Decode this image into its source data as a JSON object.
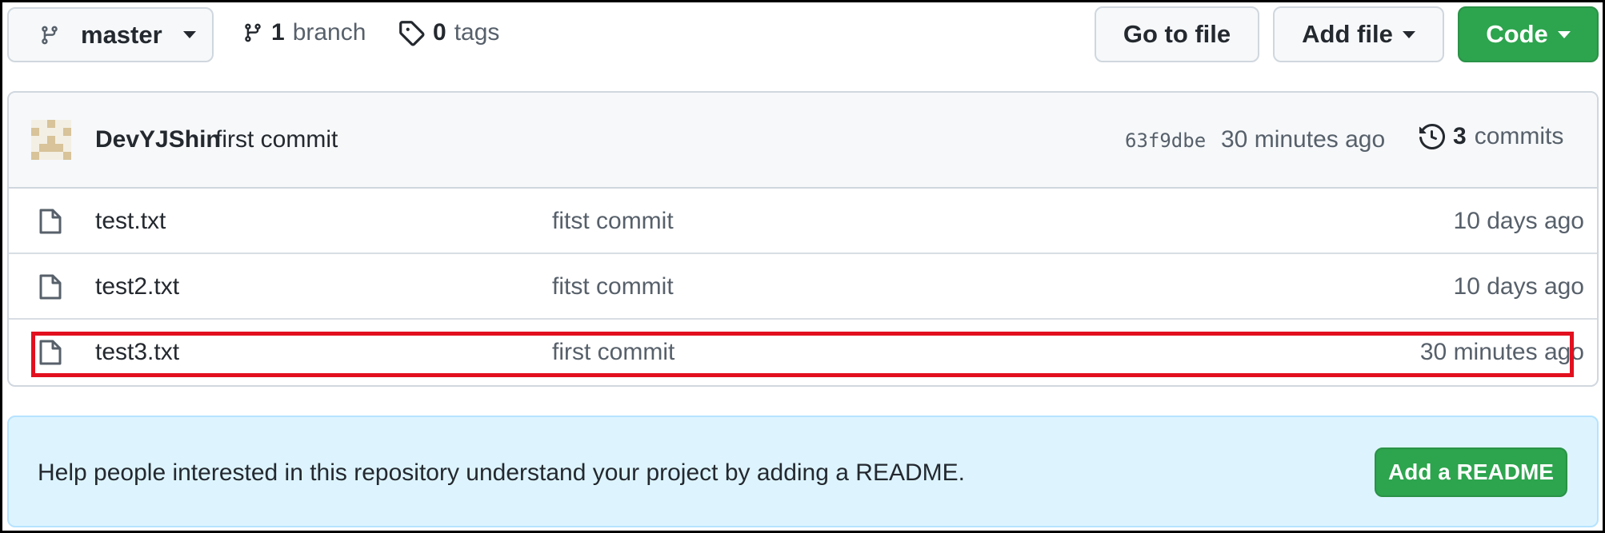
{
  "toolbar": {
    "branch_name": "master",
    "branches_count": "1",
    "branches_label": "branch",
    "tags_count": "0",
    "tags_label": "tags",
    "go_to_file_label": "Go to file",
    "add_file_label": "Add file",
    "code_label": "Code"
  },
  "latest_commit": {
    "author": "DevYJShin",
    "message": "first commit",
    "sha": "63f9dbe",
    "time": "30 minutes ago",
    "commits_count": "3",
    "commits_label": "commits"
  },
  "files": [
    {
      "name": "test.txt",
      "message": "fitst commit",
      "age": "10 days ago",
      "icon": "file-icon"
    },
    {
      "name": "test2.txt",
      "message": "fitst commit",
      "age": "10 days ago",
      "icon": "file-icon"
    },
    {
      "name": "test3.txt",
      "message": "first commit",
      "age": "30 minutes ago",
      "icon": "file-icon"
    }
  ],
  "readme_banner": {
    "text": "Help people interested in this repository understand your project by adding a README.",
    "button_label": "Add a README"
  },
  "colors": {
    "primary_green": "#2da44e",
    "banner_blue": "#ddf4ff",
    "highlight_red": "#e2101f"
  }
}
